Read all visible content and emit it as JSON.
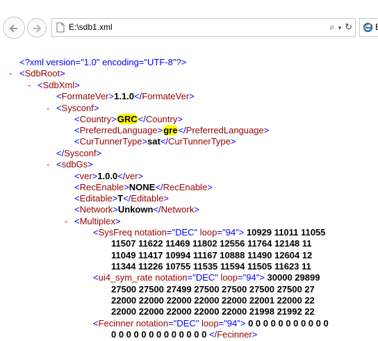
{
  "address_bar": {
    "url": "E:\\sdb1.xml",
    "search_icon": "search-icon",
    "refresh_icon": "refresh-icon"
  },
  "tab": {
    "title": "E"
  },
  "xml": {
    "declaration": "<?xml version=\"1.0\" encoding=\"UTF-8\"?>",
    "collapse_symbol": "-",
    "root": "SdbRoot",
    "sdbxml": "SdbXml",
    "formatever": {
      "tag": "FormateVer",
      "value": "1.1.0"
    },
    "sysconf": "Sysconf",
    "country": {
      "tag": "Country",
      "value": "GRC"
    },
    "preferredlanguage": {
      "tag": "PreferredLanguage",
      "value": "gre"
    },
    "curtunnertype": {
      "tag": "CurTunnerType",
      "value": "sat"
    },
    "sdbgs": "sdbGs",
    "ver": {
      "tag": "ver",
      "value": "1.0.0"
    },
    "recenable": {
      "tag": "RecEnable",
      "value": "NONE"
    },
    "editable": {
      "tag": "Editable",
      "value": "T"
    },
    "network": {
      "tag": "Network",
      "value": "Unkown"
    },
    "multiplex": "Multiplex",
    "sysfreq": {
      "tag": "SysFreq",
      "attr1": "notation",
      "attr1_val": "\"DEC\"",
      "attr2": "loop",
      "attr2_val": "\"94\"",
      "lines": [
        "10929 11011 11055",
        "11507 11622 11469 11802 12556 11764 12148 11",
        "11049 11417 10994 11167 10888 11490 12604 12",
        "11344 11226 10755 11535 11594 11505 11623 11"
      ]
    },
    "symrate": {
      "tag": "ui4_sym_rate",
      "attr1": "notation",
      "attr1_val": "\"DEC\"",
      "attr2": "loop",
      "attr2_val": "\"94\"",
      "lines": [
        "30000 29899",
        "27500 27500 27499 27500 27500 27500 27500 27",
        "22000 22000 22000 22000 22000 22001 22000 22",
        "22000 22000 22000 22000 22000 21998 21992 22"
      ]
    },
    "fecinner": {
      "tag": "Fecinner",
      "attr1": "notation",
      "attr1_val": "\"DEC\"",
      "attr2": "loop",
      "attr2_val": "\"94\"",
      "lines": [
        "0 0 0 0 0 0 0 0 0 0 0",
        "0 0 0 0 0 0 0 0 0 0 0 0 0"
      ]
    }
  }
}
